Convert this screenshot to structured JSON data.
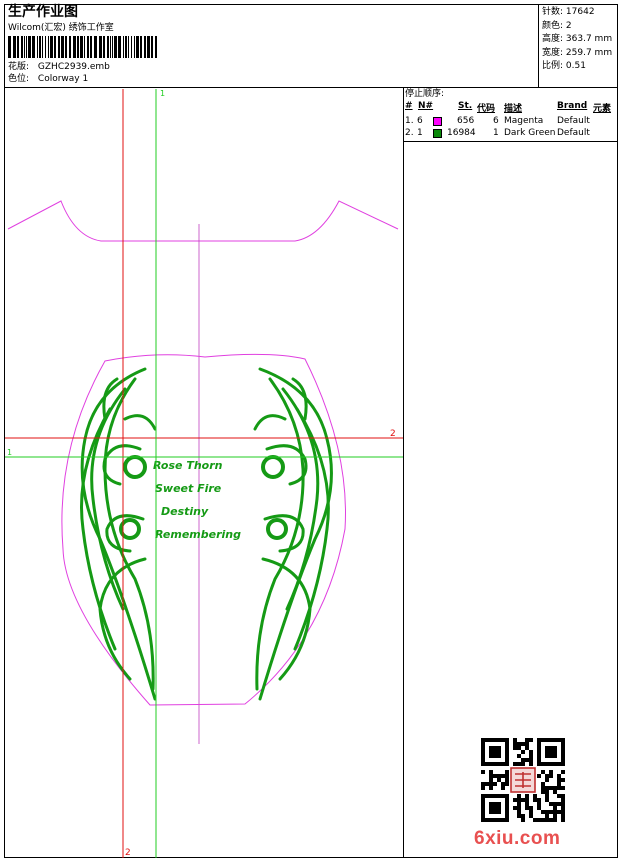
{
  "header": {
    "title": "生产作业图",
    "company": "Wilcom(汇宏) 绣饰工作室",
    "design_label": "花版:",
    "design_file": "GZHC2939.emb",
    "colorway_label": "色位:",
    "colorway": "Colorway 1"
  },
  "stats": [
    {
      "label": "针数:",
      "value": "17642"
    },
    {
      "label": "颜色:",
      "value": "2"
    },
    {
      "label": "高度:",
      "value": "363.7 mm"
    },
    {
      "label": "宽度:",
      "value": "259.7 mm"
    },
    {
      "label": "比例:",
      "value": "0.51"
    }
  ],
  "stop_sequence": {
    "title": "停止顺序:",
    "columns": [
      "#",
      "N#",
      "St.",
      "代码",
      "描述",
      "Brand",
      "元素"
    ],
    "rows": [
      {
        "num": "1.",
        "needle": "6",
        "color": "#ff00ff",
        "stitches": "656",
        "code": "6",
        "desc": "Magenta",
        "brand": "Default"
      },
      {
        "num": "2.",
        "needle": "1",
        "color": "#0a8a0a",
        "stitches": "16984",
        "code": "1",
        "desc": "Dark Green",
        "brand": "Default"
      }
    ]
  },
  "guides": {
    "green_marker": "1",
    "red_marker": "2"
  },
  "canvas": {
    "embroidery_lines": [
      "Rose Thorn",
      "Sweet Fire",
      "Destiny",
      "Remembering"
    ]
  },
  "watermark": "6xiu.com",
  "colors": {
    "magenta_outline": "#e040e0",
    "embroidery_green": "#159a15",
    "guide_red": "#e01010",
    "guide_green": "#22cc22"
  }
}
